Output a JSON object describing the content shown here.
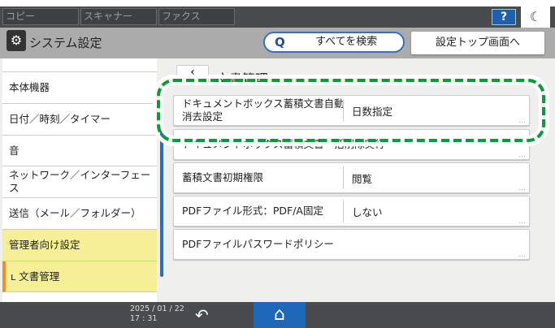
{
  "topbar": {
    "tabs": [
      "コピー",
      "スキャナー",
      "ファクス"
    ],
    "help_label": "?",
    "moon_icon": "moon-icon"
  },
  "header": {
    "title": "システム設定",
    "search_label": "すべてを検索",
    "top_button": "設定トップ画面へ"
  },
  "sidebar": {
    "items": [
      {
        "label": "本体機器"
      },
      {
        "label": "日付／時刻／タイマー"
      },
      {
        "label": "音"
      },
      {
        "label": "ネットワーク／インターフェース"
      },
      {
        "label": "送信（メール／フォルダー）"
      },
      {
        "label": "管理者向け設定"
      },
      {
        "label": "ʟ 文書管理"
      }
    ]
  },
  "main": {
    "title": "文書管理",
    "rows": [
      {
        "label": "ドキュメントボックス蓄積文書自動消去設定",
        "value": "日数指定"
      },
      {
        "label": "ドキュメントボックス蓄積文書一括削除実行",
        "value": ""
      },
      {
        "label": "蓄積文書初期権限",
        "value": "閲覧"
      },
      {
        "label": "PDFファイル形式：PDF/A固定",
        "value": "しない"
      },
      {
        "label": "PDFファイルパスワードポリシー",
        "value": ""
      }
    ],
    "more": "..."
  },
  "footer": {
    "date": "2025 / 01 / 22",
    "time": "17 : 31"
  },
  "colors": {
    "highlight": "#0a9a3c",
    "accent": "#1f68b8",
    "selected": "#f7ee98"
  }
}
